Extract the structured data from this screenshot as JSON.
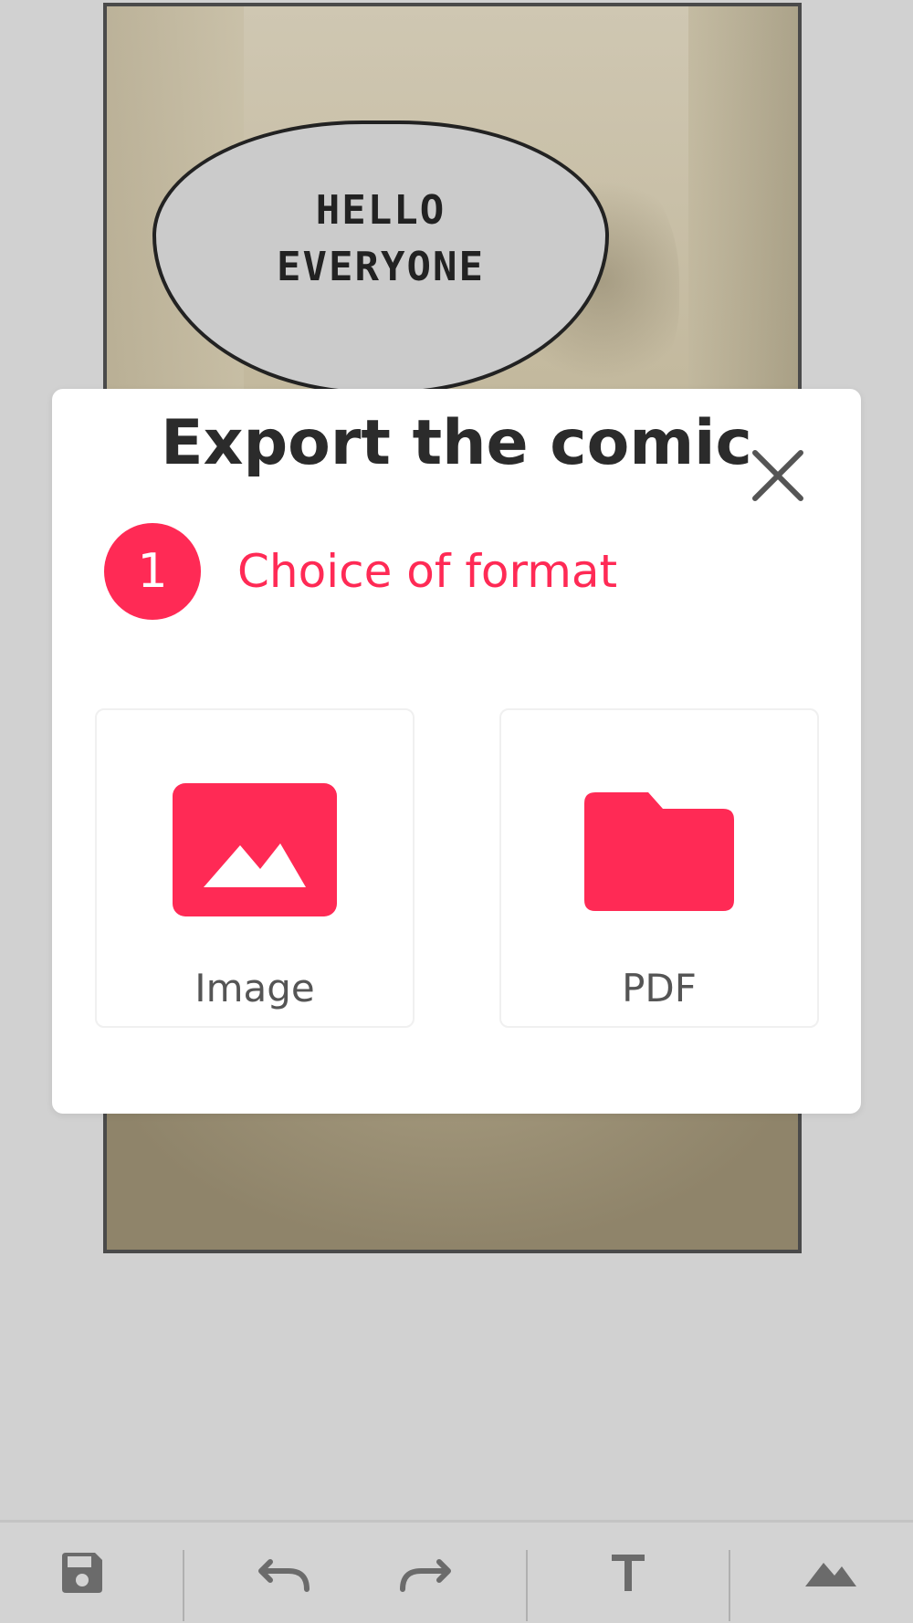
{
  "comic": {
    "speech_line_1": "HELLO",
    "speech_line_2": "EVERYONE"
  },
  "modal": {
    "title": "Export the comic",
    "step": {
      "number": "1",
      "label": "Choice of format"
    },
    "options": [
      {
        "label": "Image",
        "icon": "image-icon"
      },
      {
        "label": "PDF",
        "icon": "folder-icon"
      }
    ]
  },
  "toolbar": {
    "items": [
      "save-icon",
      "undo-icon",
      "redo-icon",
      "text-icon",
      "image-icon"
    ]
  },
  "colors": {
    "accent": "#ff2a55",
    "background": "#d1d1d1",
    "icon_gray": "#6b6b6b"
  }
}
